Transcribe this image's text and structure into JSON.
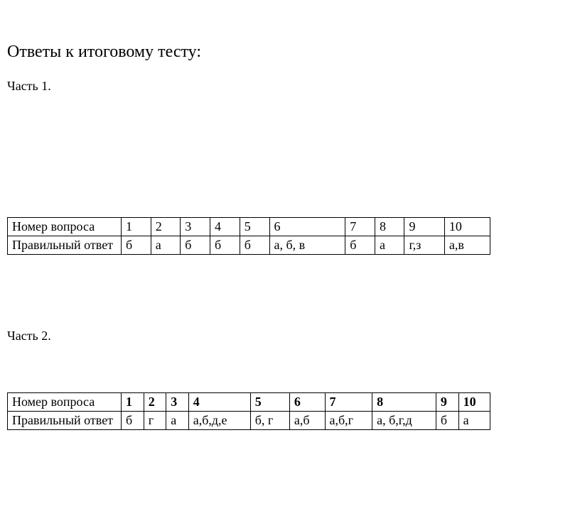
{
  "title": "Ответы к итоговому тесту:",
  "part1Label": "Часть 1.",
  "part2Label": "Часть 2.",
  "rowQuestionLabel": "Номер вопроса",
  "rowAnswerLabel": "Правильный ответ",
  "part1": {
    "headers": [
      "1",
      "2",
      "3",
      "4",
      "5",
      "6",
      "7",
      "8",
      "9",
      "10"
    ],
    "answers": [
      "б",
      "а",
      "б",
      "б",
      "б",
      "а, б, в",
      "б",
      "а",
      "г,з",
      "а,в"
    ]
  },
  "part2": {
    "headers": [
      "1",
      "2",
      "3",
      "4",
      "5",
      "6",
      "7",
      "8",
      "9",
      "10"
    ],
    "answers": [
      "б",
      "г",
      "а",
      "а,б,д,е",
      "б, г",
      "а,б",
      "а,б,г",
      "а, б,г,д",
      "б",
      "а"
    ]
  }
}
